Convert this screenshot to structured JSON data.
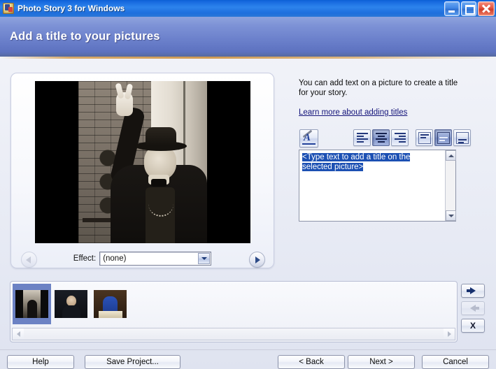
{
  "window": {
    "title": "Photo Story 3 for Windows",
    "minimize_label": "Minimize",
    "maximize_label": "Maximize",
    "close_label": "Close"
  },
  "header": {
    "title": "Add a title to your pictures"
  },
  "preview": {
    "effect_label": "Effect:",
    "effect_value": "(none)",
    "prev_label": "Previous picture",
    "next_label": "Next picture"
  },
  "instructions": {
    "line1": "You can add text on a picture to create a title",
    "line2": "for your story.",
    "link": "Learn more about adding titles"
  },
  "format_toolbar": {
    "font_button": "Select Font, Color and Style",
    "align_left": "Align Left",
    "align_center": "Align Center",
    "align_right": "Align Right",
    "valign_top": "Align Top",
    "valign_middle": "Align Middle",
    "valign_bottom": "Align Bottom",
    "align_selected": "align_center",
    "valign_selected": "valign_middle"
  },
  "title_text": {
    "placeholder": "<Type text to add a title on the selected picture>",
    "value": "<Type text to add a title on the selected picture>",
    "selected": true
  },
  "filmstrip": {
    "items": [
      {
        "label": "Picture 1",
        "selected": true
      },
      {
        "label": "Picture 2",
        "selected": false
      },
      {
        "label": "Picture 3",
        "selected": false
      }
    ],
    "scroll_left": "Scroll left",
    "scroll_right": "Scroll right",
    "move_forward": "Move picture forward",
    "move_back": "Move picture back",
    "delete": "X"
  },
  "footer": {
    "help": "Help",
    "save_project": "Save Project...",
    "back": "< Back",
    "next": "Next >",
    "cancel": "Cancel"
  },
  "colors": {
    "titlebar_blue": "#2d83ec",
    "banner_violet": "#6b80cb",
    "selection_blue": "#1c50b3",
    "link_navy": "#14147a",
    "accent_rule": "#cf9b55"
  }
}
